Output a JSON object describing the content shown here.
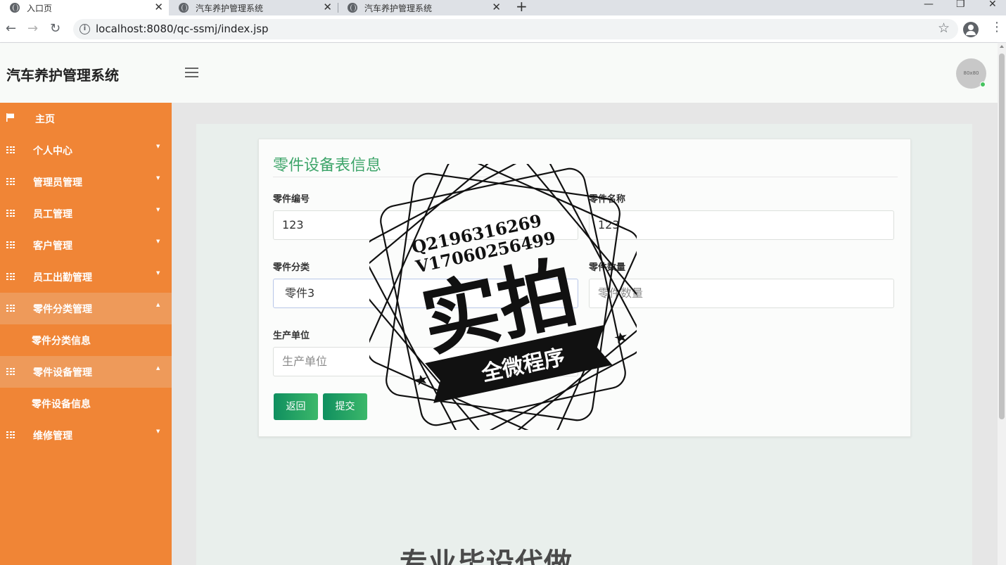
{
  "browser": {
    "tabs": [
      {
        "title": "入口页",
        "active": true
      },
      {
        "title": "汽车养护管理系统",
        "active": false
      },
      {
        "title": "汽车养护管理系统",
        "active": false
      }
    ],
    "url": "localhost:8080/qc-ssmj/index.jsp"
  },
  "header": {
    "brand": "汽车养护管理系统",
    "avatar_text": "80x80"
  },
  "sidebar": {
    "items": [
      {
        "label": "主页",
        "icon": "flag-icon"
      },
      {
        "label": "个人中心",
        "icon": "grid-icon"
      },
      {
        "label": "管理员管理",
        "icon": "grid-icon"
      },
      {
        "label": "员工管理",
        "icon": "grid-icon"
      },
      {
        "label": "客户管理",
        "icon": "grid-icon"
      },
      {
        "label": "员工出勤管理",
        "icon": "grid-icon"
      },
      {
        "label": "零件分类管理",
        "icon": "grid-icon",
        "open": true,
        "sub": "零件分类信息"
      },
      {
        "label": "零件设备管理",
        "icon": "grid-icon",
        "open": true,
        "sub": "零件设备信息"
      },
      {
        "label": "维修管理",
        "icon": "grid-icon"
      }
    ]
  },
  "form": {
    "title": "零件设备表信息",
    "fields": {
      "part_no": {
        "label": "零件编号",
        "value": "123"
      },
      "part_name": {
        "label": "零件名称",
        "value": "123"
      },
      "category": {
        "label": "零件分类",
        "value": "零件3"
      },
      "quantity": {
        "label": "零件数量",
        "placeholder": "零件数量"
      },
      "manufacturer": {
        "label": "生产单位",
        "placeholder": "生产单位"
      }
    },
    "buttons": {
      "back": "返回",
      "submit": "提交"
    }
  },
  "watermark": {
    "contact_q": "Q2196316269",
    "contact_v": "V17060256499",
    "big_text": "实拍",
    "ribbon_text": "全微程序",
    "bottom_text": "专业毕设代做"
  },
  "colors": {
    "sidebar": "#f08536",
    "sidebar_open": "#ee9a5a",
    "title_green": "#3ea56a",
    "button_green": "#1a9a62"
  }
}
